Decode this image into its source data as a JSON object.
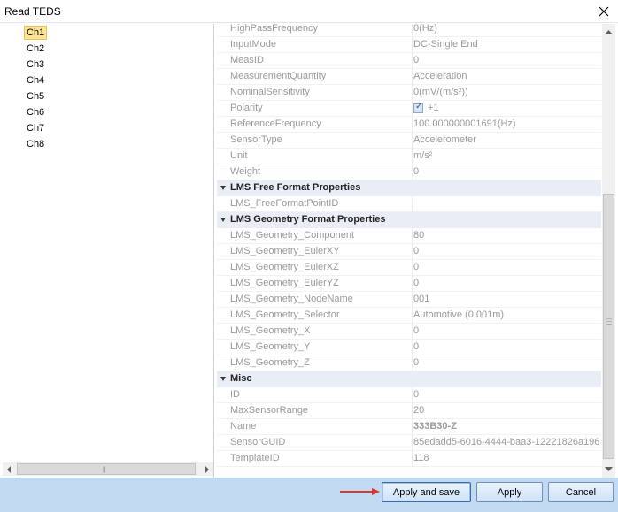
{
  "window": {
    "title": "Read TEDS"
  },
  "channels": [
    "Ch1",
    "Ch2",
    "Ch3",
    "Ch4",
    "Ch5",
    "Ch6",
    "Ch7",
    "Ch8"
  ],
  "properties": {
    "general": [
      {
        "key": "HighPassFrequency",
        "value": "0(Hz)"
      },
      {
        "key": "InputMode",
        "value": "DC-Single End"
      },
      {
        "key": "MeasID",
        "value": "0"
      },
      {
        "key": "MeasurementQuantity",
        "value": "Acceleration"
      },
      {
        "key": "NominalSensitivity",
        "value": "0(mV/(m/s²))"
      },
      {
        "key": "Polarity",
        "value": "+1"
      },
      {
        "key": "ReferenceFrequency",
        "value": "100.000000001691(Hz)"
      },
      {
        "key": "SensorType",
        "value": "Accelerometer"
      },
      {
        "key": "Unit",
        "value": "m/s²"
      },
      {
        "key": "Weight",
        "value": "0"
      }
    ],
    "free_format": {
      "title": "LMS Free Format Properties",
      "rows": [
        {
          "key": "LMS_FreeFormatPointID",
          "value": ""
        }
      ]
    },
    "geometry": {
      "title": "LMS Geometry Format Properties",
      "rows": [
        {
          "key": "LMS_Geometry_Component",
          "value": "80"
        },
        {
          "key": "LMS_Geometry_EulerXY",
          "value": "0"
        },
        {
          "key": "LMS_Geometry_EulerXZ",
          "value": "0"
        },
        {
          "key": "LMS_Geometry_EulerYZ",
          "value": "0"
        },
        {
          "key": "LMS_Geometry_NodeName",
          "value": "001"
        },
        {
          "key": "LMS_Geometry_Selector",
          "value": "Automotive (0.001m)"
        },
        {
          "key": "LMS_Geometry_X",
          "value": "0"
        },
        {
          "key": "LMS_Geometry_Y",
          "value": "0"
        },
        {
          "key": "LMS_Geometry_Z",
          "value": "0"
        }
      ]
    },
    "misc": {
      "title": "Misc",
      "rows": [
        {
          "key": "ID",
          "value": "0"
        },
        {
          "key": "MaxSensorRange",
          "value": "20"
        },
        {
          "key": "Name",
          "value": "333B30-Z"
        },
        {
          "key": "SensorGUID",
          "value": "85edadd5-6016-4444-baa3-12221826a196"
        },
        {
          "key": "TemplateID",
          "value": "118"
        }
      ]
    }
  },
  "buttons": {
    "apply_and_save": "Apply and save",
    "apply": "Apply",
    "cancel": "Cancel"
  },
  "colors": {
    "selected_channel": "#fde58f",
    "footer": "#c2d9f2",
    "category": "#e9eef6",
    "annotation_arrow": "#e0342b"
  }
}
